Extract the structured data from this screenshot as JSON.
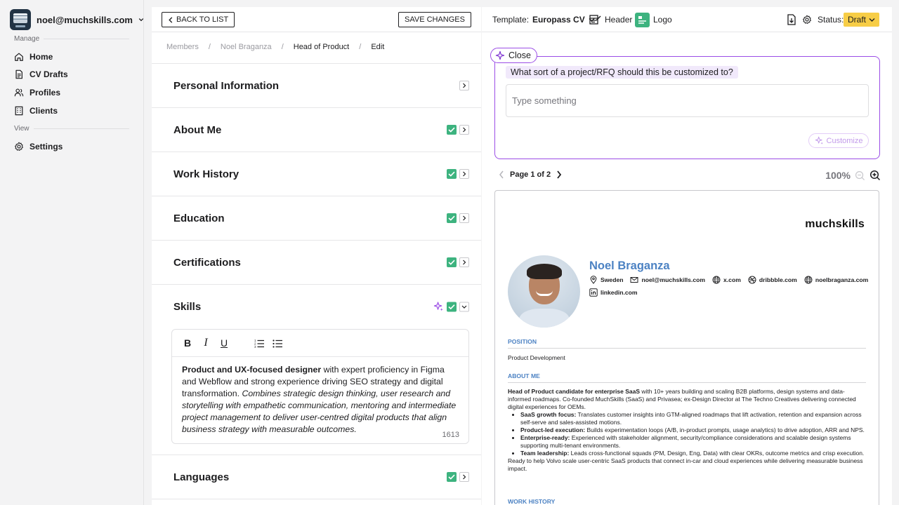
{
  "account": {
    "email": "noel@muchskills.com"
  },
  "sidebar": {
    "manage_label": "Manage",
    "view_label": "View",
    "items": [
      {
        "label": "Home",
        "icon": "home-icon"
      },
      {
        "label": "CV Drafts",
        "icon": "document-icon"
      },
      {
        "label": "Profiles",
        "icon": "users-icon"
      },
      {
        "label": "Clients",
        "icon": "building-icon"
      }
    ],
    "settings": {
      "label": "Settings",
      "icon": "gear-icon"
    }
  },
  "editor_panel": {
    "back_label": "BACK TO LIST",
    "save_label": "SAVE CHANGES",
    "breadcrumb": [
      "Members",
      "Noel Braganza",
      "Head of Product",
      "Edit"
    ],
    "sections": [
      {
        "title": "Personal Information",
        "checked": false,
        "expanded": false
      },
      {
        "title": "About Me",
        "checked": true,
        "expanded": false
      },
      {
        "title": "Work History",
        "checked": true,
        "expanded": false
      },
      {
        "title": "Education",
        "checked": true,
        "expanded": false
      },
      {
        "title": "Certifications",
        "checked": true,
        "expanded": false
      },
      {
        "title": "Skills",
        "checked": true,
        "expanded": true,
        "ai": true
      },
      {
        "title": "Languages",
        "checked": true,
        "expanded": false
      }
    ],
    "skills_editor": {
      "toolbar": [
        "B",
        "I",
        "U",
        "ordered-list",
        "bullet-list"
      ],
      "bold_text": "Product and UX-focused designer",
      "plain_text": " with expert proficiency in Figma and Webflow and strong experience driving SEO strategy and digital transformation. ",
      "italic_text": "Combines strategic design thinking, user research and storytelling with empathetic communication, mentoring and intermediate project management to deliver user-centred digital products that align business strategy with measurable outcomes.",
      "char_count": "1613"
    }
  },
  "preview_panel": {
    "template_label": "Template:",
    "template_value": "Europass CV",
    "header_label": "Header",
    "logo_label": "Logo",
    "status_label": "Status:",
    "status_value": "Draft",
    "ai": {
      "close_label": "Close",
      "question": "What sort of a project/RFQ should this be customized to?",
      "input_placeholder": "Type something",
      "customize_label": "Customize"
    },
    "pager": {
      "label": "Page 1 of 2"
    },
    "zoom": "100%",
    "cv": {
      "brand": "muchskills",
      "name": "Noel Braganza",
      "contacts": [
        {
          "icon": "location-pin-icon",
          "text": "Sweden"
        },
        {
          "icon": "mail-icon",
          "text": "noel@muchskills.com"
        },
        {
          "icon": "globe-icon",
          "text": "x.com"
        },
        {
          "icon": "dribbble-icon",
          "text": "dribbble.com"
        },
        {
          "icon": "globe-icon",
          "text": "noelbraganza.com"
        },
        {
          "icon": "linkedin-icon",
          "text": "linkedin.com"
        }
      ],
      "position_heading": "POSITION",
      "position_value": "Product Development",
      "about_heading": "ABOUT ME",
      "about_intro_bold": "Head of Product candidate for enterprise SaaS",
      "about_intro": " with 10+ years building and scaling B2B platforms, design systems and data-informed roadmaps. Co-founded MuchSkills (SaaS) and Privasea; ex-Design Director at The Techno Creatives delivering connected digital experiences for OEMs.",
      "bullets": [
        {
          "bold": "SaaS growth focus:",
          "text": " Translates customer insights into GTM-aligned roadmaps that lift activation, retention and expansion across self-serve and sales-assisted motions."
        },
        {
          "bold": "Product-led execution:",
          "text": " Builds experimentation loops (A/B, in-product prompts, usage analytics) to drive adoption, ARR and NPS."
        },
        {
          "bold": "Enterprise-ready:",
          "text": " Experienced with stakeholder alignment, security/compliance considerations and scalable design systems supporting multi-tenant environments."
        },
        {
          "bold": "Team leadership:",
          "text": " Leads cross-functional squads (PM, Design, Eng, Data) with clear OKRs, outcome metrics and crisp execution."
        }
      ],
      "about_outro": "Ready to help Volvo scale user-centric SaaS products that connect in-car and cloud experiences while delivering measurable business impact.",
      "work_heading": "WORK HISTORY"
    }
  },
  "colors": {
    "accent_purple": "#9b4de6",
    "check_green": "#3db37f",
    "status_yellow": "#f7cd46",
    "cv_blue": "#4c82c3"
  }
}
